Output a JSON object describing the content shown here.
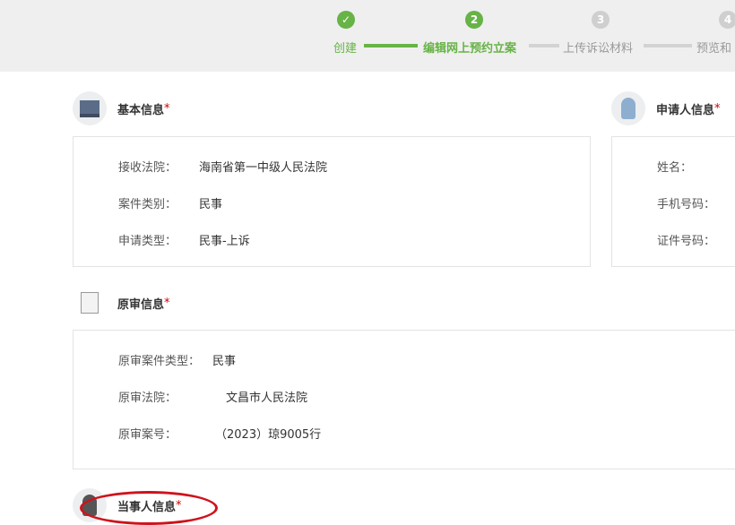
{
  "steps": [
    {
      "label": "创建",
      "num": "✓",
      "state": "done"
    },
    {
      "label": "编辑网上预约立案",
      "num": "2",
      "state": "active"
    },
    {
      "label": "上传诉讼材料",
      "num": "3",
      "state": "todo"
    },
    {
      "label": "预览和",
      "num": "4",
      "state": "todo"
    }
  ],
  "basic": {
    "title": "基本信息",
    "star": "*",
    "rows": [
      {
        "label": "接收法院：",
        "value": "海南省第一中级人民法院"
      },
      {
        "label": "案件类别：",
        "value": "民事"
      },
      {
        "label": "申请类型：",
        "value": "民事-上诉"
      }
    ]
  },
  "applicant": {
    "title": "申请人信息",
    "star": "*",
    "rows": [
      {
        "label": "姓名："
      },
      {
        "label": "手机号码："
      },
      {
        "label": "证件号码："
      }
    ]
  },
  "original": {
    "title": "原审信息",
    "star": "*",
    "rows": [
      {
        "label": "原审案件类型：",
        "value": "民事"
      },
      {
        "label": "原审法院：",
        "value": "文昌市人民法院"
      },
      {
        "label": "原审案号：",
        "value": "（2023）琼9005行"
      }
    ]
  },
  "party": {
    "title": "当事人信息",
    "star": "*"
  },
  "colors": {
    "green": "#67b346",
    "gray": "#cfcfcf",
    "annotation": "#d0121b"
  }
}
